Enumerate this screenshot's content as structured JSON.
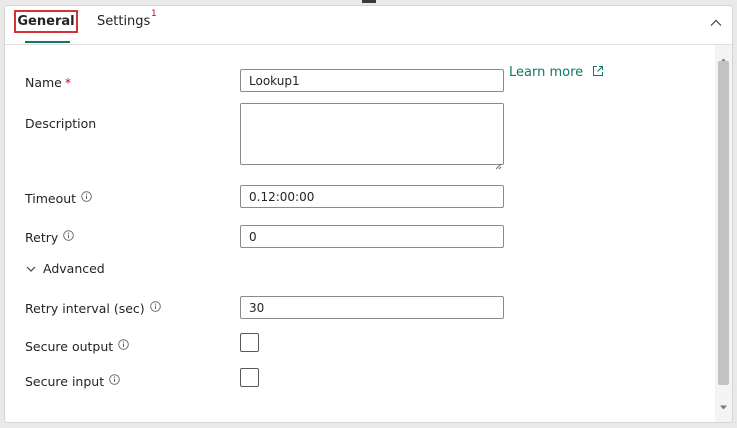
{
  "tabs": {
    "general": {
      "label": "General"
    },
    "settings": {
      "label": "Settings",
      "badge": "1"
    }
  },
  "form": {
    "name": {
      "label": "Name",
      "required_mark": "*",
      "value": "Lookup1"
    },
    "learn_more": {
      "label": "Learn more"
    },
    "description": {
      "label": "Description",
      "value": ""
    },
    "timeout": {
      "label": "Timeout",
      "value": "0.12:00:00"
    },
    "retry": {
      "label": "Retry",
      "value": "0"
    },
    "advanced": {
      "label": "Advanced"
    },
    "retry_interval": {
      "label": "Retry interval (sec)",
      "value": "30"
    },
    "secure_output": {
      "label": "Secure output"
    },
    "secure_input": {
      "label": "Secure input"
    }
  },
  "icons": {
    "info": "info-icon",
    "external": "external-link-icon",
    "chevron_down": "chevron-down-icon",
    "chevron_up": "chevron-up-icon"
  },
  "colors": {
    "accent": "#117865",
    "highlight_border": "#d13438",
    "required": "#c50f1f"
  }
}
